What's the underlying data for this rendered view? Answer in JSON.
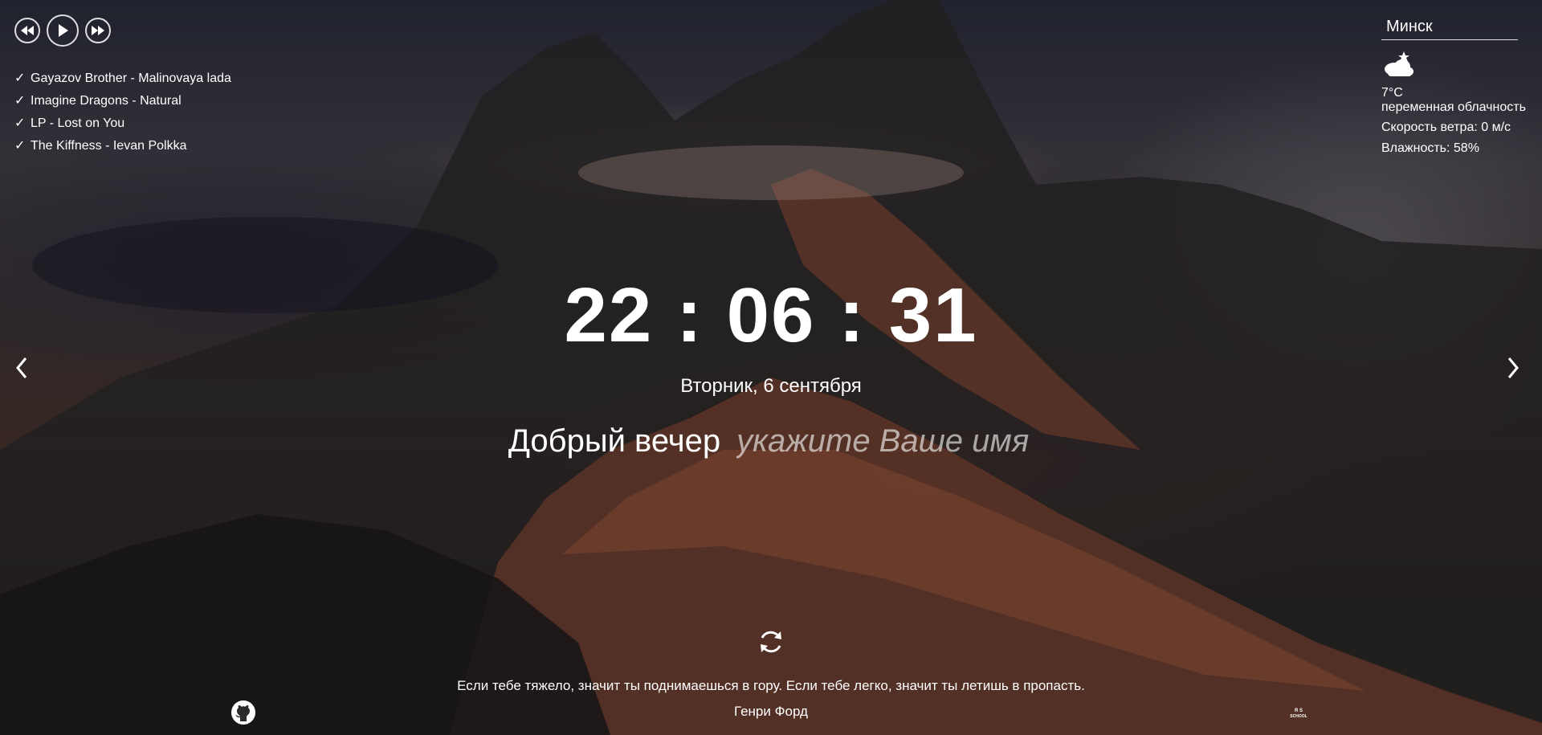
{
  "player": {
    "prev_icon": "rewind-icon",
    "play_icon": "play-icon",
    "next_icon": "fast-forward-icon",
    "check_icon": "✓",
    "playlist": [
      {
        "title": "Gayazov Brother - Malinovaya lada"
      },
      {
        "title": "Imagine Dragons - Natural"
      },
      {
        "title": "LP - Lost on You"
      },
      {
        "title": "The Kiffness - Ievan Polkka"
      }
    ]
  },
  "weather": {
    "city": "Минск",
    "icon": "partly-cloudy-night-icon",
    "temperature": "7°C",
    "description": "переменная облачность",
    "wind": "Скорость ветра: 0 м/с",
    "humidity": "Влажность: 58%"
  },
  "clock": {
    "time": "22 : 06 : 31",
    "date": "Вторник, 6 сентября"
  },
  "greeting": {
    "text": "Добрый вечер",
    "name_placeholder": "укажите Ваше имя",
    "name_value": ""
  },
  "quote": {
    "text": "Если тебе тяжело, значит ты поднимаешься в гору. Если тебе легко, значит ты летишь в пропасть.",
    "author": "Генри Форд",
    "refresh_icon": "refresh-icon"
  },
  "footer": {
    "github_icon": "github-icon",
    "logo_icon": "rs-school-logo-icon",
    "logo_text": "RS SCHOOL"
  },
  "slider": {
    "prev_icon": "chevron-left-icon",
    "next_icon": "chevron-right-icon"
  }
}
